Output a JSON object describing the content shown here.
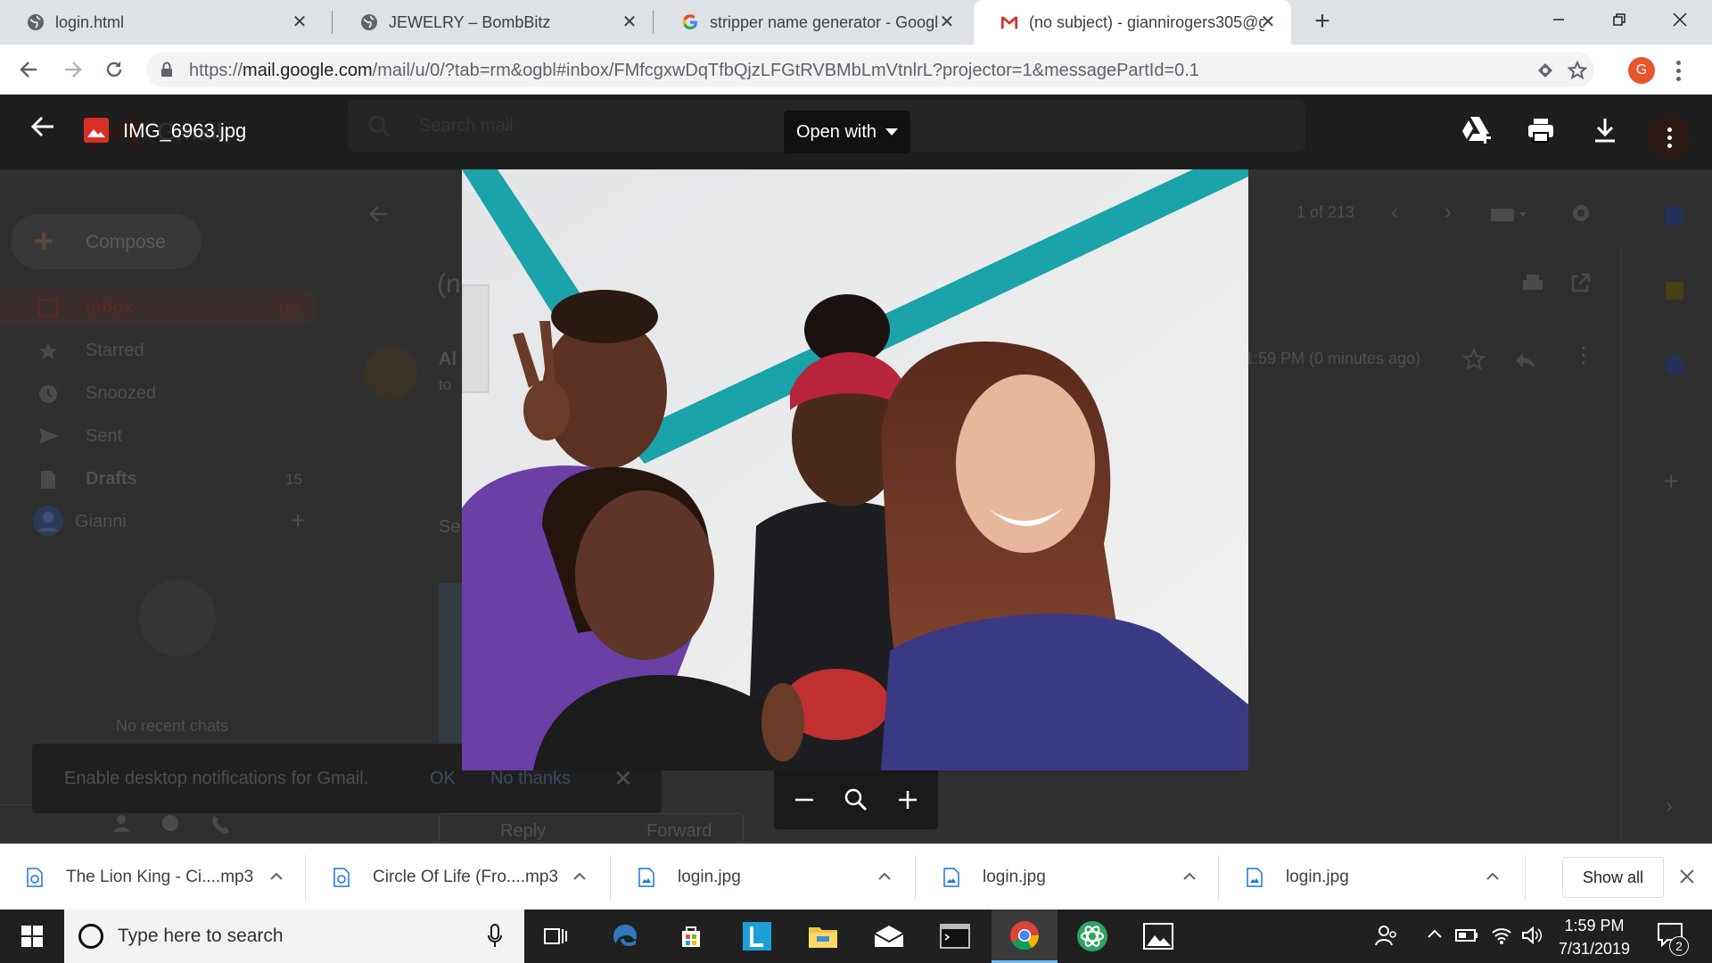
{
  "browser": {
    "tabs": [
      {
        "title": "login.html",
        "favicon": "globe-icon",
        "active": false
      },
      {
        "title": "JEWELRY – BombBitz",
        "favicon": "globe-icon",
        "active": false
      },
      {
        "title": "stripper name generator - Googl",
        "favicon": "google-icon",
        "active": false
      },
      {
        "title": "(no subject) - giannirogers305@g",
        "favicon": "gmail-icon",
        "active": true
      }
    ],
    "url_scheme": "https://",
    "url_host": "mail.google.com",
    "url_rest": "/mail/u/0/?tab=rm&ogbl#inbox/FMfcgxwDqTfbQjzLFGtRVBMbLmVtnlrL?projector=1&messagePartId=0.1",
    "profile_initial": "G",
    "profile_color": "#e8542e"
  },
  "gmail_background": {
    "app_name": "Gmail",
    "search_placeholder": "Search mail",
    "compose_label": "Compose",
    "nav": [
      {
        "label": "Inbox",
        "count": "161",
        "icon": "inbox-icon"
      },
      {
        "label": "Starred",
        "count": "",
        "icon": "star-icon"
      },
      {
        "label": "Snoozed",
        "count": "",
        "icon": "clock-icon"
      },
      {
        "label": "Sent",
        "count": "",
        "icon": "send-icon"
      },
      {
        "label": "Drafts",
        "count": "15",
        "icon": "draft-icon"
      }
    ],
    "account_name": "Gianni",
    "no_chats": "No recent chats",
    "pagination": "1 of 213",
    "subject_fragment": "(n",
    "sender_fragment": "Al",
    "to_fragment": "to",
    "timestamp": "1:59 PM (0 minutes ago)",
    "body_fragment": "Se",
    "reply_label": "Reply",
    "forward_label": "Forward",
    "notification": {
      "message": "Enable desktop notifications for Gmail.",
      "ok": "OK",
      "no_thanks": "No thanks"
    }
  },
  "viewer": {
    "filename": "IMG_6963.jpg",
    "open_with": "Open with",
    "photo_description_colors": {
      "wall": "#e9e9ea",
      "stripe": "#1aa3a8"
    }
  },
  "downloads": [
    {
      "name": "The Lion King - Ci....mp3",
      "type": "audio"
    },
    {
      "name": "Circle Of Life (Fro....mp3",
      "type": "audio"
    },
    {
      "name": "login.jpg",
      "type": "image"
    },
    {
      "name": "login.jpg",
      "type": "image"
    },
    {
      "name": "login.jpg",
      "type": "image"
    }
  ],
  "show_all_label": "Show all",
  "taskbar": {
    "search_placeholder": "Type here to search",
    "time": "1:59 PM",
    "date": "7/31/2019",
    "notification_count": "2"
  }
}
